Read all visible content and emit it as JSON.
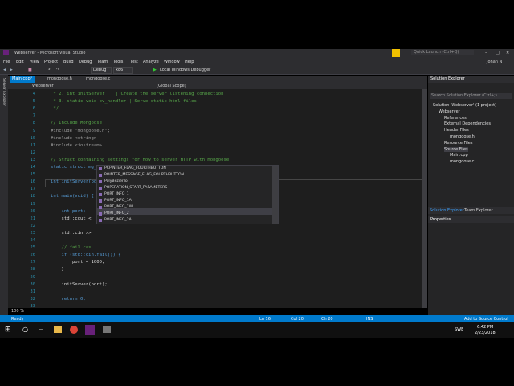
{
  "window": {
    "title": "Webserver - Microsoft Visual Studio",
    "quick_launch": "Quick Launch (Ctrl+Q)",
    "user": "Johan N"
  },
  "menu": [
    "File",
    "Edit",
    "View",
    "Project",
    "Build",
    "Debug",
    "Team",
    "Tools",
    "Test",
    "Analyze",
    "Window",
    "Help"
  ],
  "toolbar": {
    "config": "Debug",
    "platform": "x86",
    "run": "Local Windows Debugger"
  },
  "tabs": [
    {
      "label": "Main.cpp*"
    },
    {
      "label": "mongoose.h"
    },
    {
      "label": "mongoose.c"
    }
  ],
  "nav": {
    "project": "Webserver",
    "scope": "(Global Scope)"
  },
  "code_lines": [
    {
      "n": "4",
      "t": " * 2. int initServer    | Create the server listening connection",
      "c": "cm"
    },
    {
      "n": "5",
      "t": " * 3. static void ev_handler | Serve static html files",
      "c": "cm"
    },
    {
      "n": "6",
      "t": " */",
      "c": "cm"
    },
    {
      "n": "7",
      "t": "",
      "c": ""
    },
    {
      "n": "8",
      "t": "// Include Mongoose",
      "c": "cm"
    },
    {
      "n": "9",
      "t": "#include \"mongoose.h\";",
      "c": "pp"
    },
    {
      "n": "10",
      "t": "#include <string>",
      "c": "pp"
    },
    {
      "n": "11",
      "t": "#include <iostream>",
      "c": "pp"
    },
    {
      "n": "12",
      "t": "",
      "c": ""
    },
    {
      "n": "13",
      "t": "// Struct containing settings for how to server HTTP with mongoose",
      "c": "cm"
    },
    {
      "n": "14",
      "t": "static struct mg_serve_http_opts s_http_server_opts;",
      "c": "kw"
    },
    {
      "n": "15",
      "t": "",
      "c": ""
    },
    {
      "n": "16",
      "t": "int initServer(port)",
      "c": "kw"
    },
    {
      "n": "17",
      "t": "",
      "c": ""
    },
    {
      "n": "18",
      "t": "int main(void) {",
      "c": "kw"
    },
    {
      "n": "19",
      "t": "",
      "c": ""
    },
    {
      "n": "20",
      "t": "    int port;",
      "c": "kw"
    },
    {
      "n": "21",
      "t": "    std::cout <",
      "c": ""
    },
    {
      "n": "22",
      "t": "",
      "c": ""
    },
    {
      "n": "23",
      "t": "    std::cin >>",
      "c": ""
    },
    {
      "n": "24",
      "t": "",
      "c": ""
    },
    {
      "n": "25",
      "t": "    // fail cas",
      "c": "cm"
    },
    {
      "n": "26",
      "t": "    if (std::cin.fail()) {",
      "c": "kw"
    },
    {
      "n": "27",
      "t": "        port = 1000;",
      "c": ""
    },
    {
      "n": "28",
      "t": "    }",
      "c": ""
    },
    {
      "n": "29",
      "t": "",
      "c": ""
    },
    {
      "n": "30",
      "t": "    initServer(port);",
      "c": ""
    },
    {
      "n": "31",
      "t": "",
      "c": ""
    },
    {
      "n": "32",
      "t": "    return 0;",
      "c": "kw"
    },
    {
      "n": "33",
      "t": "",
      "c": ""
    }
  ],
  "autocomplete": [
    "PCPINTER_FLAG_FOURTHBUTTON",
    "POINTER_MESSAGE_FLAG_FOURTHBUTTON",
    "PolyBezierTo",
    "POPERATION_START_PARAMETERS",
    "PORT_INFO_1",
    "PORT_INFO_1A",
    "PORT_INFO_1W",
    "PORT_INFO_2",
    "PORT_INFO_2A"
  ],
  "solution_explorer": {
    "title": "Solution Explorer",
    "search": "Search Solution Explorer (Ctrl+;)",
    "items": [
      {
        "label": "Solution 'Webserver' (1 project)",
        "indent": 0
      },
      {
        "label": "Webserver",
        "indent": 1
      },
      {
        "label": "References",
        "indent": 2
      },
      {
        "label": "External Dependencies",
        "indent": 2
      },
      {
        "label": "Header Files",
        "indent": 2
      },
      {
        "label": "mongoose.h",
        "indent": 3
      },
      {
        "label": "Resource Files",
        "indent": 2
      },
      {
        "label": "Source Files",
        "indent": 2
      },
      {
        "label": "Main.cpp",
        "indent": 3
      },
      {
        "label": "mongoose.c",
        "indent": 3
      }
    ],
    "tabs": [
      "Solution Explorer",
      "Team Explorer"
    ],
    "properties": "Properties"
  },
  "status": {
    "state": "Ready",
    "ln": "Ln 16",
    "col": "Col 20",
    "ch": "Ch 20",
    "mode": "INS",
    "source": "Add to Source Control"
  },
  "zoom": "100 %",
  "clock": {
    "time": "6:42 PM",
    "date": "2/23/2018",
    "lang": "SWE"
  }
}
